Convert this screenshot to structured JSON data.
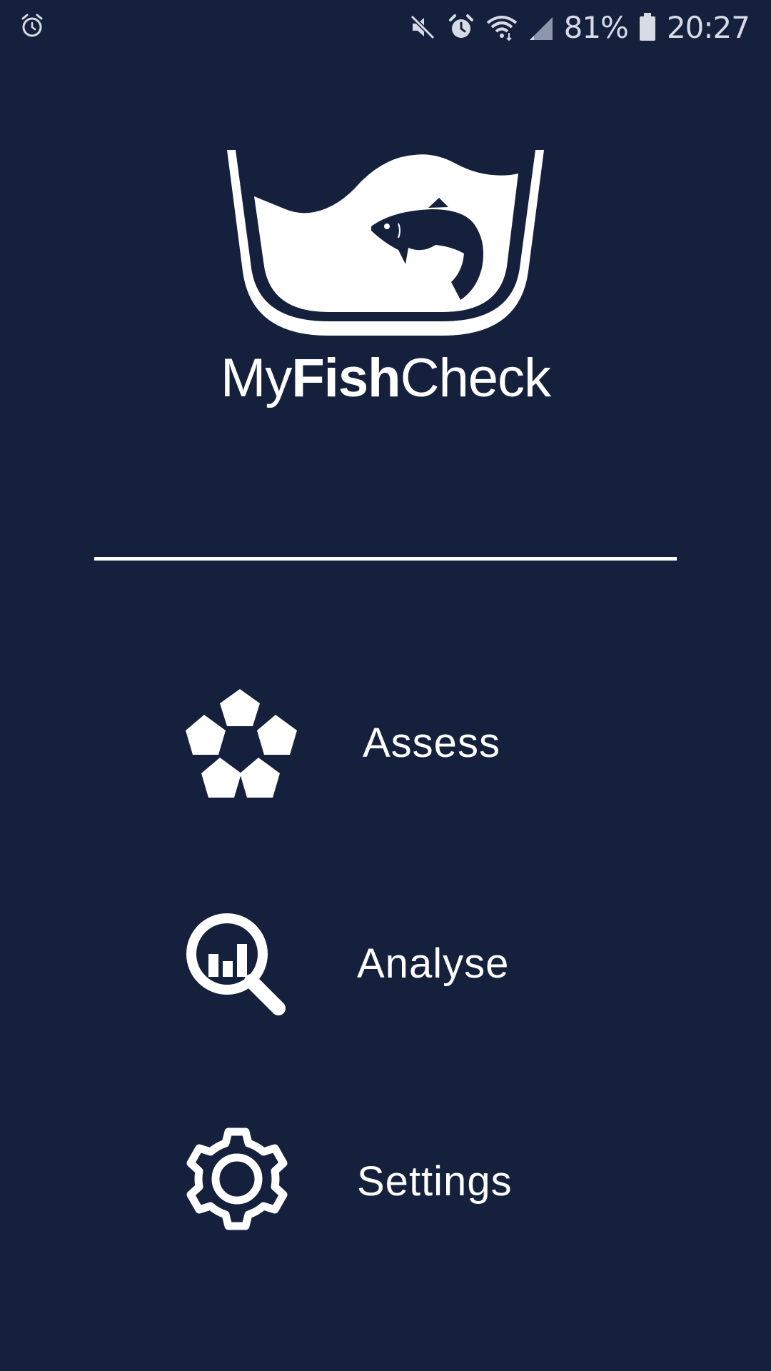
{
  "status_bar": {
    "battery_percent": "81%",
    "time": "20:27",
    "icons": [
      "alarm-icon",
      "mute-icon",
      "alarm-icon",
      "wifi-icon",
      "signal-icon",
      "battery-icon"
    ]
  },
  "app": {
    "title_prefix": "My",
    "title_bold": "Fish",
    "title_suffix": "Check",
    "logo_icon": "fish-bowl-logo"
  },
  "menu": {
    "items": [
      {
        "label": "Assess",
        "icon": "pentagons-icon"
      },
      {
        "label": "Analyse",
        "icon": "magnifier-chart-icon"
      },
      {
        "label": "Settings",
        "icon": "gear-icon"
      }
    ]
  },
  "colors": {
    "background": "#15203d",
    "foreground": "#ffffff",
    "status_text": "#d7dbe6"
  }
}
